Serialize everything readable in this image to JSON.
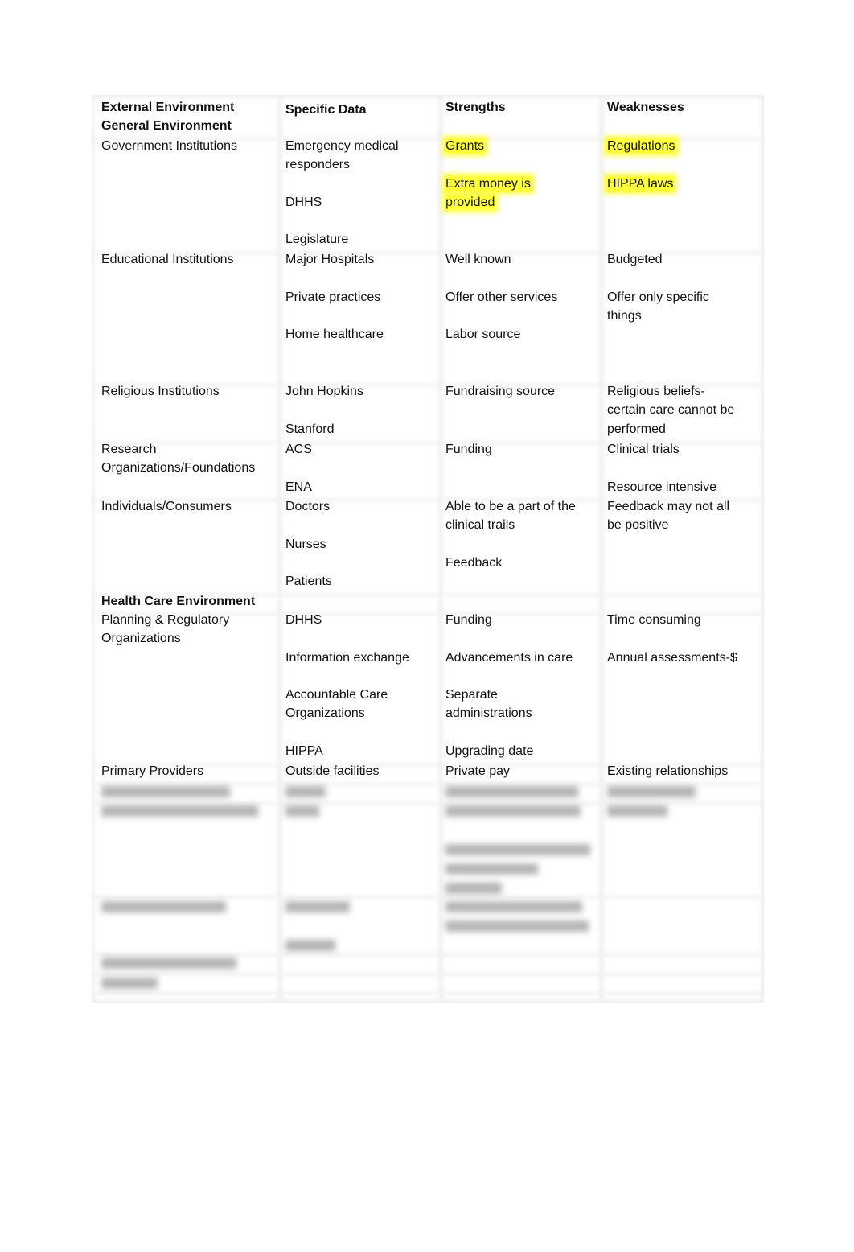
{
  "header": {
    "col1": [
      "External Environment",
      "General Environment"
    ],
    "col2": "Specific Data",
    "col3": "Strengths",
    "col4": "Weaknesses"
  },
  "highlight_color": "#ffff3a",
  "rows": [
    {
      "cells": [
        [
          [
            "Government Institutions"
          ]
        ],
        [
          [
            "Emergency medical",
            "responders"
          ],
          [
            "DHHS"
          ],
          [
            "Legislature"
          ]
        ],
        {
          "highlight": true,
          "paras": [
            [
              "Grants"
            ],
            [
              "Extra money is",
              "provided"
            ]
          ]
        },
        {
          "highlight": true,
          "paras": [
            [
              "Regulations"
            ],
            [
              "HIPPA laws"
            ]
          ]
        }
      ]
    },
    {
      "cells": [
        [
          [
            "Educational Institutions"
          ]
        ],
        [
          [
            "Major Hospitals"
          ],
          [
            "Private practices"
          ],
          [
            "Home healthcare"
          ]
        ],
        [
          [
            "Well known"
          ],
          [
            "Offer other services"
          ],
          [
            "Labor source"
          ]
        ],
        [
          [
            "Budgeted"
          ],
          [
            "Offer only specific",
            "things"
          ]
        ]
      ]
    },
    {
      "cells": [
        [
          [
            "Religious Institutions"
          ]
        ],
        [
          [
            "John Hopkins"
          ],
          [
            "Stanford"
          ]
        ],
        [
          [
            "Fundraising source"
          ]
        ],
        [
          [
            "Religious beliefs-",
            "certain care cannot be",
            "performed"
          ]
        ]
      ]
    },
    {
      "cells": [
        [
          [
            "Research",
            "Organizations/Foundations"
          ]
        ],
        [
          [
            "ACS"
          ],
          [
            "ENA"
          ]
        ],
        [
          [
            "Funding"
          ]
        ],
        [
          [
            "Clinical trials"
          ],
          [
            "Resource intensive"
          ]
        ]
      ]
    },
    {
      "cells": [
        [
          [
            "Individuals/Consumers"
          ]
        ],
        [
          [
            "Doctors"
          ],
          [
            "Nurses"
          ],
          [
            "Patients"
          ]
        ],
        [
          [
            "Able to be a part of the",
            "clinical trails"
          ],
          [
            "Feedback"
          ]
        ],
        [
          [
            "Feedback may not all",
            "be positive"
          ]
        ]
      ]
    },
    {
      "section": "Health Care Environment"
    },
    {
      "cells": [
        [
          [
            "Planning & Regulatory",
            "Organizations"
          ]
        ],
        [
          [
            "DHHS"
          ],
          [
            "Information exchange"
          ],
          [
            "Accountable Care",
            "Organizations"
          ],
          [
            "HIPPA"
          ]
        ],
        [
          [
            "Funding"
          ],
          [
            "Advancements in care"
          ],
          [
            "Separate",
            "administrations"
          ],
          [
            "Upgrading date"
          ]
        ],
        [
          [
            "Time consuming"
          ],
          [
            "Annual assessments-$"
          ]
        ]
      ]
    },
    {
      "cells": [
        [
          [
            "Primary Providers"
          ]
        ],
        [
          [
            "Outside facilities"
          ]
        ],
        [
          [
            "Private pay"
          ]
        ],
        [
          [
            "Existing relationships"
          ]
        ]
      ]
    }
  ]
}
